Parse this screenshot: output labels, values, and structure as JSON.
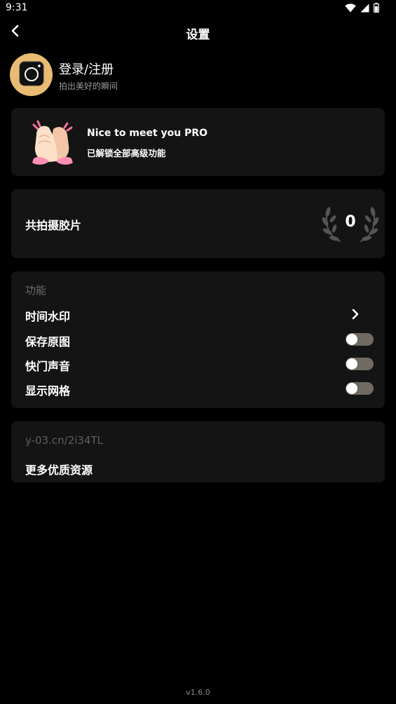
{
  "status_bar": {
    "time": "9:31",
    "icons": [
      "wifi-icon",
      "cellular-icon",
      "battery-icon"
    ]
  },
  "nav": {
    "back_icon": "chevron-left-icon",
    "title": "设置"
  },
  "profile": {
    "avatar_icon": "camera-app-icon",
    "name": "登录/注册",
    "subtitle": "拍出美好的瞬间"
  },
  "pro_banner": {
    "emoji_icon": "clapping-hands-icon",
    "title": "Nice to meet you PRO",
    "subtitle": "已解锁全部高级功能"
  },
  "stats": {
    "label": "共拍摄胶片",
    "count": "0",
    "decoration_icon": "laurel-wreath-icon"
  },
  "features": {
    "section_title": "功能",
    "items": [
      {
        "label": "时间水印",
        "control": "chevron",
        "icon": "chevron-right-icon"
      },
      {
        "label": "保存原图",
        "control": "toggle",
        "on": false
      },
      {
        "label": "快门声音",
        "control": "toggle",
        "on": false
      },
      {
        "label": "显示网格",
        "control": "toggle",
        "on": false
      }
    ]
  },
  "resources": {
    "url": "y-03.cn/2i34TL",
    "title": "更多优质资源"
  },
  "footer": {
    "version": "v1.6.0"
  },
  "colors": {
    "background": "#000000",
    "card": "#141414",
    "avatar_bg": "#e8bc72",
    "toggle_off": "#6f6a63",
    "muted_text": "#6d6d6d"
  }
}
